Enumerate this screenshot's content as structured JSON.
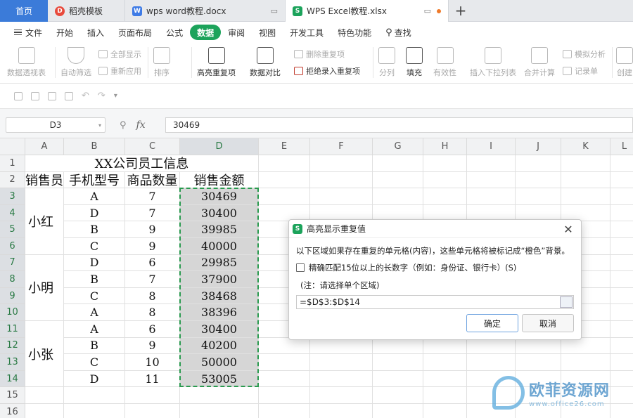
{
  "tabs": {
    "home": "首页",
    "docer": "稻壳模板",
    "word_doc": "wps word教程.docx",
    "excel_doc": "WPS Excel教程.xlsx",
    "add": "+"
  },
  "menu": [
    "文件",
    "开始",
    "插入",
    "页面布局",
    "公式",
    "数据",
    "审阅",
    "视图",
    "开发工具",
    "特色功能",
    "查找"
  ],
  "menu_active": "数据",
  "ribbon": {
    "pivot": "数据透视表",
    "autofilter": "自动筛选",
    "show_all": "全部显示",
    "reapply": "重新应用",
    "sort": "排序",
    "highlight_dup": "高亮重复项",
    "compare": "数据对比",
    "remove_dup": "删除重复项",
    "reject_dup": "拒绝录入重复项",
    "split": "分列",
    "fill": "填充",
    "validity": "有效性",
    "dropdown": "插入下拉列表",
    "consolidate": "合并计算",
    "simulate": "模拟分析",
    "records": "记录单",
    "create": "创建"
  },
  "formula_bar": {
    "name_box": "D3",
    "fx": "fx",
    "value": "30469"
  },
  "columns": [
    "A",
    "B",
    "C",
    "D",
    "E",
    "F",
    "G",
    "H",
    "I",
    "J",
    "K",
    "L"
  ],
  "rows": [
    "1",
    "2",
    "3",
    "4",
    "5",
    "6",
    "7",
    "8",
    "9",
    "10",
    "11",
    "12",
    "13",
    "14",
    "15",
    "16"
  ],
  "sheet": {
    "title": "XX公司员工信息",
    "headers": [
      "销售员",
      "手机型号",
      "商品数量",
      "销售金额"
    ],
    "groups": [
      "小红",
      "小明",
      "小张"
    ],
    "models": [
      "A",
      "D",
      "B",
      "C",
      "D",
      "B",
      "C",
      "A",
      "A",
      "B",
      "C",
      "D"
    ],
    "quantities": [
      "7",
      "7",
      "9",
      "9",
      "6",
      "7",
      "8",
      "8",
      "6",
      "9",
      "10",
      "11"
    ],
    "amounts": [
      "30469",
      "30400",
      "39985",
      "40000",
      "29985",
      "37900",
      "38468",
      "38396",
      "30400",
      "40200",
      "50000",
      "53005"
    ]
  },
  "dialog": {
    "title": "高亮显示重复值",
    "description": "以下区域如果存在重复的单元格(内容)，这些单元格将被标记成“橙色”背景。",
    "checkbox_label": "精确匹配15位以上的长数字（例如：身份证、银行卡）(S)",
    "note": "(注：请选择单个区域)",
    "range": "=$D$3:$D$14",
    "ok": "确定",
    "cancel": "取消"
  },
  "watermark": {
    "main": "欧菲资源网",
    "sub": "www.office26.com"
  },
  "colors": {
    "accent": "#1ca35b",
    "home_tab": "#3b7bd9",
    "selection": "#d6d6d6",
    "marquee": "#2a9a4f"
  }
}
